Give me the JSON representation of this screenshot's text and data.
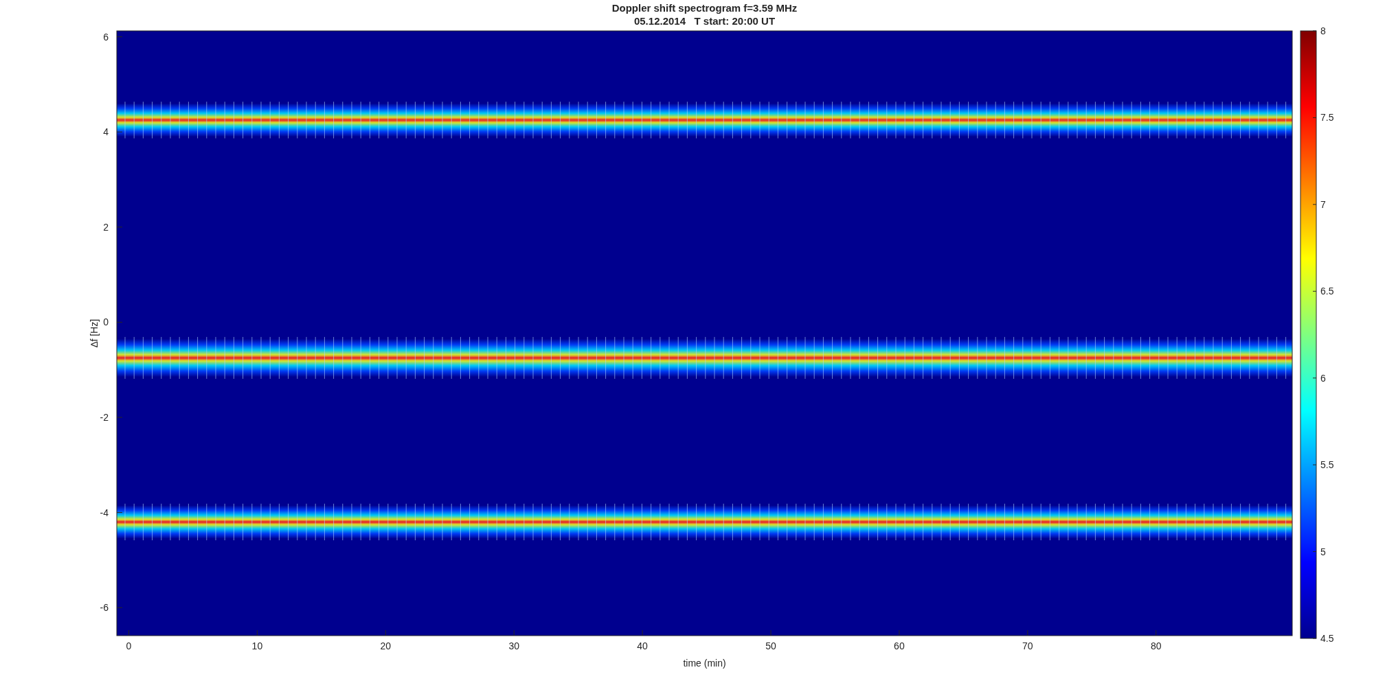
{
  "title": {
    "line_1": "Doppler shift spectrogram f=3.59 MHz",
    "line_2": "05.12.2014   T start: 20:00 UT"
  },
  "axes": {
    "xlabel": "time (min)",
    "ylabel": "∆f [Hz]",
    "xticks": [
      "0",
      "10",
      "20",
      "30",
      "40",
      "50",
      "60",
      "70",
      "80"
    ],
    "yticks": [
      "6",
      "4",
      "2",
      "0",
      "-2",
      "-4",
      "-6"
    ]
  },
  "colorbar": {
    "ticks": [
      "8",
      "7.5",
      "7",
      "6.5",
      "6",
      "5.5",
      "5",
      "4.5"
    ]
  }
}
